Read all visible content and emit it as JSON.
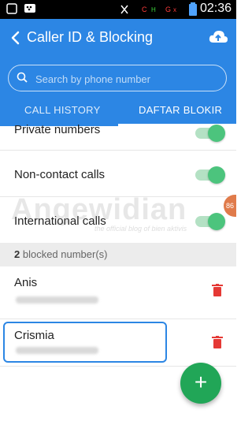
{
  "status_bar": {
    "time": "02:36",
    "icons": [
      "notification-icon",
      "bbm-icon",
      "mute-icon",
      "signal-icon",
      "battery-icon"
    ]
  },
  "header": {
    "title": "Caller ID & Blocking",
    "search_placeholder": "Search by phone number",
    "tabs": [
      {
        "label": "CALL HISTORY",
        "active": false
      },
      {
        "label": "DAFTAR BLOKIR",
        "active": true
      }
    ],
    "color": "#2c86e4"
  },
  "settings": [
    {
      "label": "Private numbers",
      "enabled": true
    },
    {
      "label": "Non-contact calls",
      "enabled": true
    },
    {
      "label": "International calls",
      "enabled": true
    }
  ],
  "blocked": {
    "count": "2",
    "count_suffix": " blocked number(s)",
    "entries": [
      {
        "name": "Anis"
      },
      {
        "name": "Crismia"
      }
    ]
  },
  "fab": {
    "label": "+",
    "color": "#21a657"
  },
  "watermark": {
    "text": "Angewidian",
    "subtitle": "the official blog of bien aktivis"
  },
  "scroll_badge": "86"
}
